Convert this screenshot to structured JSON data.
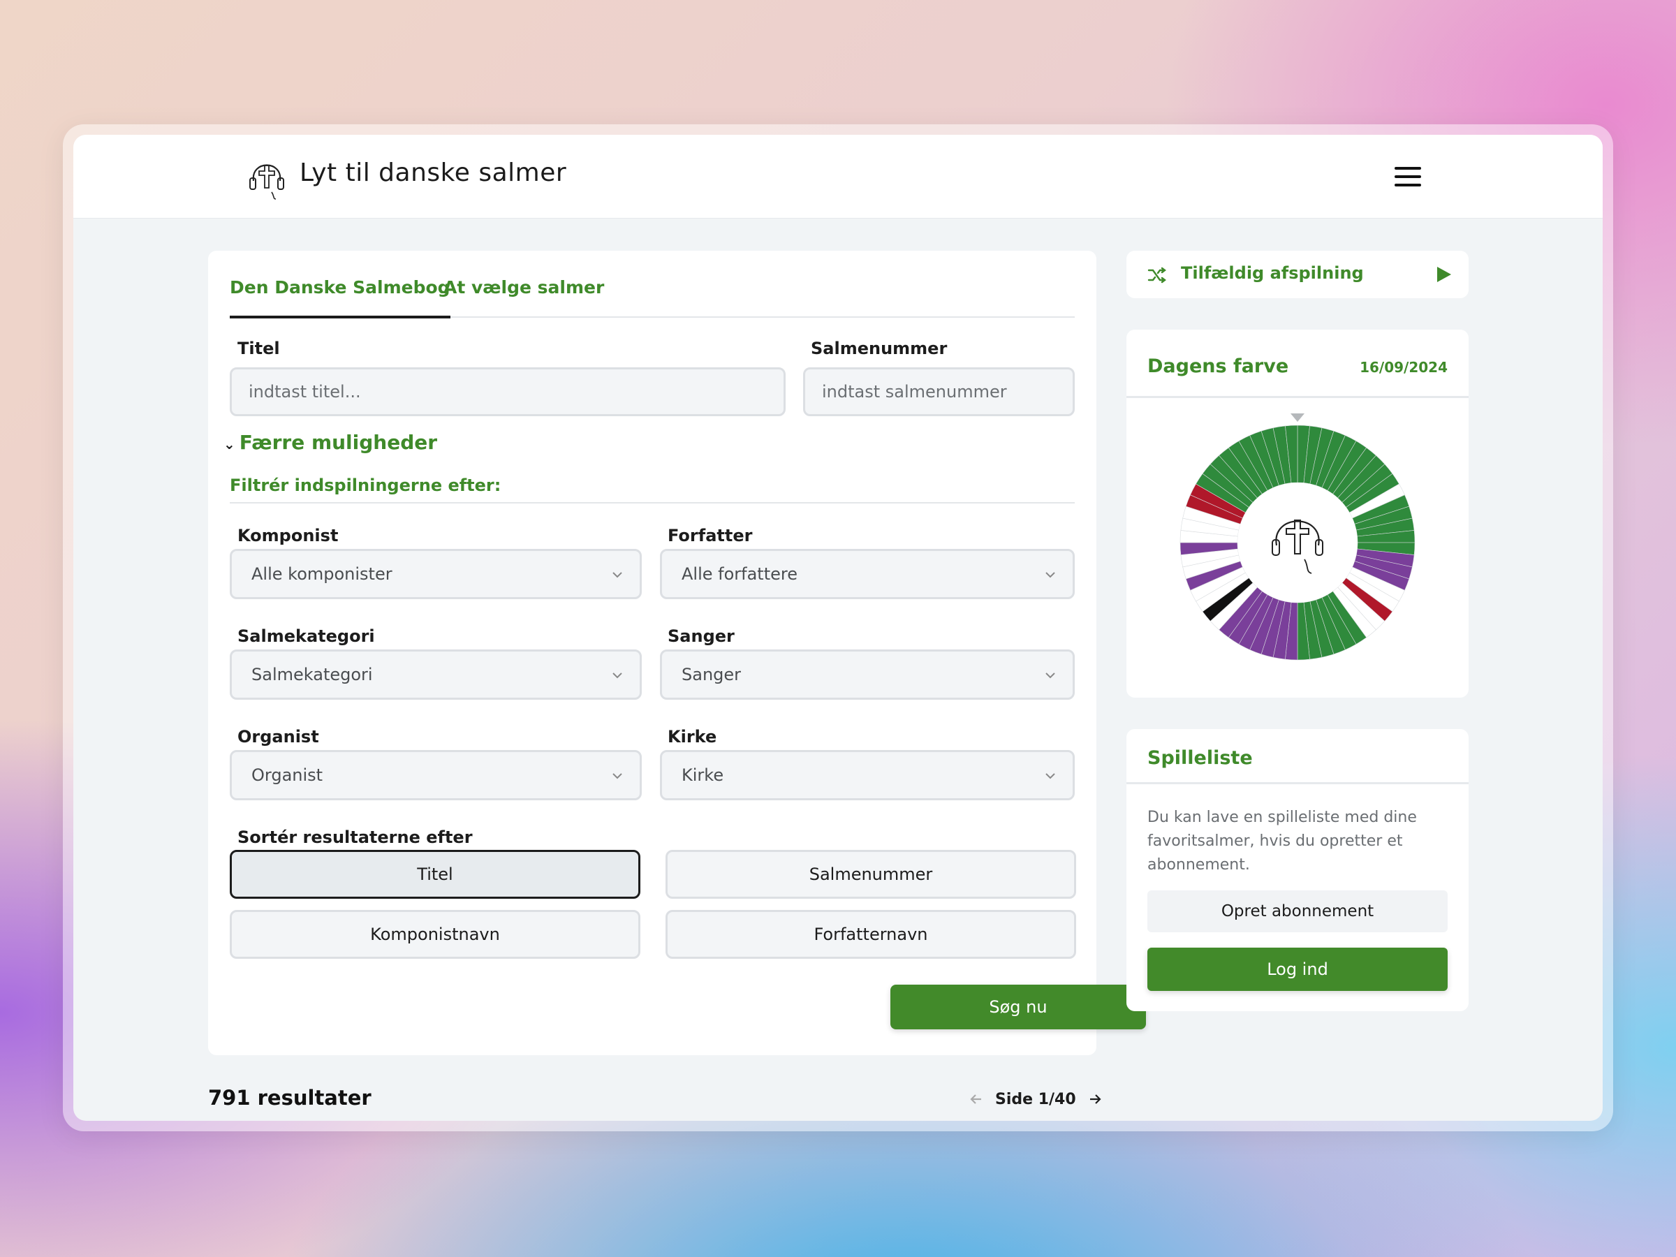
{
  "header": {
    "app_title": "Lyt til danske salmer",
    "logo_icon": "cross-headphones-logo-icon",
    "menu_icon": "hamburger-menu-icon"
  },
  "tabs": [
    {
      "label": "Den Danske Salmebog",
      "active": true
    },
    {
      "label": "At vælge salmer",
      "active": false
    }
  ],
  "search": {
    "title_label": "Titel",
    "title_placeholder": "indtast titel...",
    "number_label": "Salmenummer",
    "number_placeholder": "indtast salmenummer",
    "toggle_label": "Færre muligheder",
    "filter_heading": "Filtrér indspilningerne efter:",
    "filters": {
      "composer": {
        "label": "Komponist",
        "value": "Alle komponister"
      },
      "author": {
        "label": "Forfatter",
        "value": "Alle forfattere"
      },
      "category": {
        "label": "Salmekategori",
        "value": "Salmekategori"
      },
      "singer": {
        "label": "Sanger",
        "value": "Sanger"
      },
      "organist": {
        "label": "Organist",
        "value": "Organist"
      },
      "church": {
        "label": "Kirke",
        "value": "Kirke"
      }
    },
    "sort_label": "Sortér resultaterne efter",
    "sort_options": [
      {
        "label": "Titel",
        "active": true
      },
      {
        "label": "Salmenummer",
        "active": false
      },
      {
        "label": "Komponistnavn",
        "active": false
      },
      {
        "label": "Forfatternavn",
        "active": false
      }
    ],
    "submit_label": "Søg nu"
  },
  "results": {
    "count_text": "791 resultater",
    "page_text": "Side 1/40"
  },
  "random": {
    "label": "Tilfældig afspilning"
  },
  "color_of_day": {
    "heading": "Dagens farve",
    "date": "16/09/2024",
    "segment_colors": [
      "#2f8a3c",
      "#2f8a3c",
      "#2f8a3c",
      "#2f8a3c",
      "#2f8a3c",
      "#2f8a3c",
      "#2f8a3c",
      "#2f8a3c",
      "#2f8a3c",
      "#2f8a3c",
      "#ffffff",
      "#2f8a3c",
      "#2f8a3c",
      "#2f8a3c",
      "#2f8a3c",
      "#2f8a3c",
      "#7a3f9a",
      "#7a3f9a",
      "#7a3f9a",
      "#ffffff",
      "#ffffff",
      "#b0182a",
      "#ffffff",
      "#ffffff",
      "#2f8a3c",
      "#2f8a3c",
      "#2f8a3c",
      "#2f8a3c",
      "#2f8a3c",
      "#2f8a3c",
      "#7a3f9a",
      "#7a3f9a",
      "#7a3f9a",
      "#7a3f9a",
      "#7a3f9a",
      "#7a3f9a",
      "#7a3f9a",
      "#ffffff",
      "#111111",
      "#ffffff",
      "#ffffff",
      "#7a3f9a",
      "#ffffff",
      "#ffffff",
      "#7a3f9a",
      "#ffffff",
      "#ffffff",
      "#ffffff",
      "#b0182a",
      "#b0182a",
      "#2f8a3c",
      "#2f8a3c",
      "#2f8a3c",
      "#2f8a3c",
      "#2f8a3c",
      "#2f8a3c",
      "#2f8a3c",
      "#2f8a3c",
      "#2f8a3c",
      "#2f8a3c"
    ]
  },
  "playlist": {
    "heading": "Spilleliste",
    "text": "Du kan lave en spilleliste med dine favoritsalmer, hvis du opretter et abonnement.",
    "subscribe_label": "Opret abonnement",
    "login_label": "Log ind"
  },
  "colors": {
    "brand_green": "#428a2a",
    "text_dark": "#1c1c1c"
  }
}
